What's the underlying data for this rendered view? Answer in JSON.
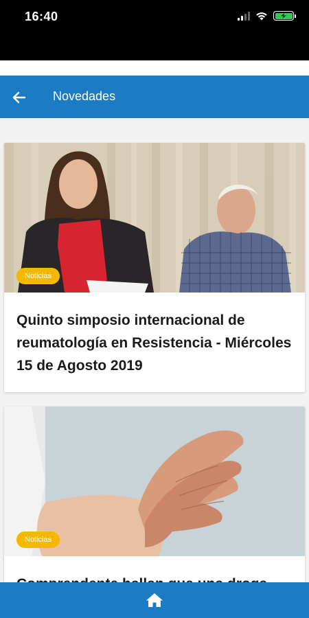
{
  "status_bar": {
    "time": "16:40"
  },
  "app_bar": {
    "title": "Novedades",
    "back_icon": "arrow-left-icon"
  },
  "news": [
    {
      "category": "Noticias",
      "title": "Quinto simposio internacional de reumatología en Resistencia - Miércoles 15 de Agosto 2019"
    },
    {
      "category": "Noticias",
      "title": "Comprendente hallan que una droga"
    }
  ],
  "bottom_nav": {
    "home_icon": "home-icon"
  },
  "colors": {
    "primary": "#1b7cc4",
    "badge": "#f5b800",
    "background": "#f2f2f2"
  }
}
